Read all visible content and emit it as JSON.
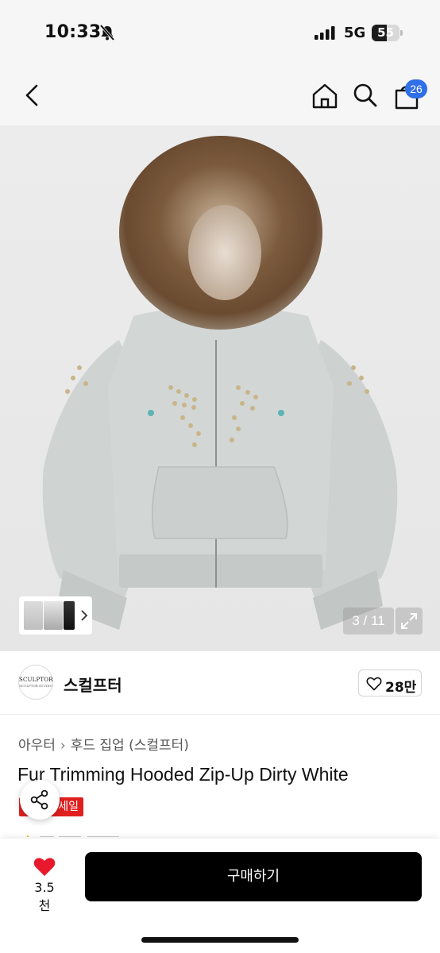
{
  "status_bar": {
    "time": "10:33",
    "network": "5G",
    "battery_level": "55",
    "battery_fraction": 0.55
  },
  "header": {
    "cart_count": "26"
  },
  "gallery": {
    "counter": "3 / 11",
    "current": 3,
    "total": 11
  },
  "store": {
    "logo_text": "SCULPTOR",
    "logo_sub": "SCULPTOR STUDIO",
    "name": "스컬프터",
    "likes": "28만"
  },
  "product": {
    "breadcrumb": [
      "아우터",
      "후드 집업 (스컬프터)"
    ],
    "title": "Fur Trimming Hooded Zip-Up Dirty White",
    "sale_label": "세일"
  },
  "bottom_bar": {
    "wish_count": "3.5천",
    "buy_label": "구매하기"
  },
  "colors": {
    "accent_blue": "#2f6fe8",
    "sale_red": "#e02020",
    "heart_red": "#e8192c",
    "buy_button": "#000000"
  }
}
